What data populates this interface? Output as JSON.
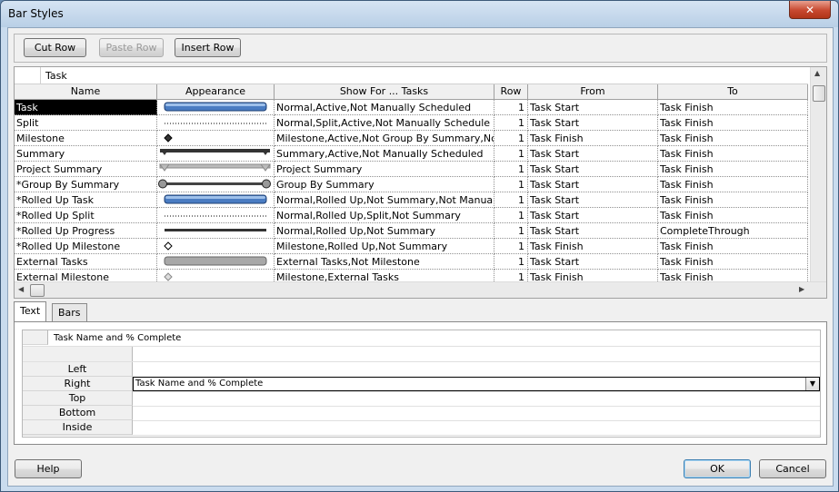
{
  "window": {
    "title": "Bar Styles",
    "close_glyph": "✕"
  },
  "toolbar": {
    "cut_row": "Cut Row",
    "paste_row": "Paste Row",
    "insert_row": "Insert Row"
  },
  "grid": {
    "edit_value": "Task",
    "columns": [
      "Name",
      "Appearance",
      "Show For ... Tasks",
      "Row",
      "From",
      "To"
    ],
    "rows": [
      {
        "name": "Task",
        "appearance": "blue-bar",
        "show_for": "Normal,Active,Not Manually Scheduled",
        "row": "1",
        "from": "Task Start",
        "to": "Task Finish",
        "selected": true
      },
      {
        "name": "Split",
        "appearance": "dotted-line",
        "show_for": "Normal,Split,Active,Not Manually Schedule",
        "row": "1",
        "from": "Task Start",
        "to": "Task Finish"
      },
      {
        "name": "Milestone",
        "appearance": "diamond-filled",
        "show_for": "Milestone,Active,Not Group By Summary,Nc",
        "row": "1",
        "from": "Task Finish",
        "to": "Task Finish"
      },
      {
        "name": "Summary",
        "appearance": "summary-bracket",
        "show_for": "Summary,Active,Not Manually Scheduled",
        "row": "1",
        "from": "Task Start",
        "to": "Task Finish"
      },
      {
        "name": "Project Summary",
        "appearance": "project-summary-bracket",
        "show_for": "Project Summary",
        "row": "1",
        "from": "Task Start",
        "to": "Task Finish"
      },
      {
        "name": "*Group By Summary",
        "appearance": "group-summary-bar",
        "show_for": "Group By Summary",
        "row": "1",
        "from": "Task Start",
        "to": "Task Finish"
      },
      {
        "name": "*Rolled Up Task",
        "appearance": "blue-bar",
        "show_for": "Normal,Rolled Up,Not Summary,Not Manua",
        "row": "1",
        "from": "Task Start",
        "to": "Task Finish"
      },
      {
        "name": "*Rolled Up Split",
        "appearance": "dotted-line",
        "show_for": "Normal,Rolled Up,Split,Not Summary",
        "row": "1",
        "from": "Task Start",
        "to": "Task Finish"
      },
      {
        "name": "*Rolled Up Progress",
        "appearance": "progress-line",
        "show_for": "Normal,Rolled Up,Not Summary",
        "row": "1",
        "from": "Task Start",
        "to": "CompleteThrough"
      },
      {
        "name": "*Rolled Up Milestone",
        "appearance": "diamond-hollow",
        "show_for": "Milestone,Rolled Up,Not Summary",
        "row": "1",
        "from": "Task Finish",
        "to": "Task Finish"
      },
      {
        "name": "External Tasks",
        "appearance": "gray-bar",
        "show_for": "External Tasks,Not Milestone",
        "row": "1",
        "from": "Task Start",
        "to": "Task Finish"
      },
      {
        "name": "External Milestone",
        "appearance": "diamond-gray",
        "show_for": "Milestone,External Tasks",
        "row": "1",
        "from": "Task Finish",
        "to": "Task Finish"
      }
    ]
  },
  "tabs": [
    "Text",
    "Bars"
  ],
  "text_tab": {
    "header_value": "Task Name and % Complete",
    "rows": [
      {
        "label": "Left",
        "value": ""
      },
      {
        "label": "Right",
        "value": "Task Name and % Complete",
        "combo": true
      },
      {
        "label": "Top",
        "value": ""
      },
      {
        "label": "Bottom",
        "value": ""
      },
      {
        "label": "Inside",
        "value": ""
      }
    ]
  },
  "buttons": {
    "help": "Help",
    "ok": "OK",
    "cancel": "Cancel"
  },
  "colors": {
    "task_bar": "#4a7cc2",
    "external_bar": "#a8a8a8"
  }
}
